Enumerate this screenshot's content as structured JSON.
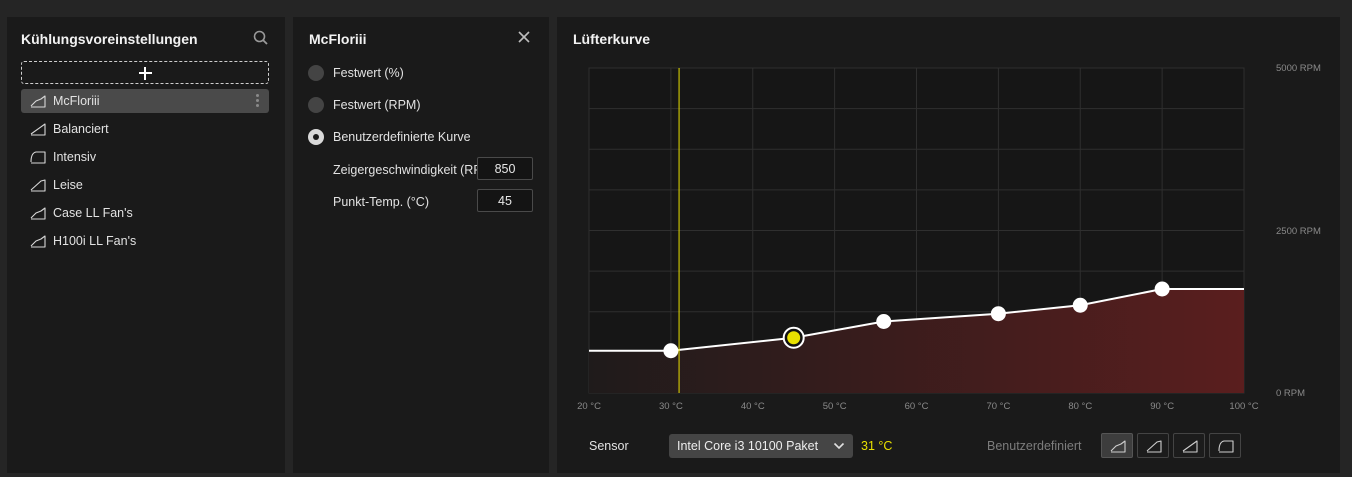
{
  "presets_panel": {
    "title": "Kühlungsvoreinstellungen",
    "items": [
      {
        "label": "McFloriii",
        "icon": "curve-custom-icon",
        "selected": true
      },
      {
        "label": "Balanciert",
        "icon": "curve-balanced-icon"
      },
      {
        "label": "Intensiv",
        "icon": "curve-intensive-icon"
      },
      {
        "label": "Leise",
        "icon": "curve-quiet-icon"
      },
      {
        "label": "Case LL Fan's",
        "icon": "curve-custom-icon"
      },
      {
        "label": "H100i LL Fan's",
        "icon": "curve-custom-icon"
      }
    ]
  },
  "settings_panel": {
    "title": "McFloriii",
    "options": [
      {
        "label": "Festwert (%)",
        "checked": false
      },
      {
        "label": "Festwert (RPM)",
        "checked": false
      },
      {
        "label": "Benutzerdefinierte Kurve",
        "checked": true
      }
    ],
    "pointer_speed_label": "Zeigergeschwindigkeit (RPM)",
    "pointer_speed_value": "850",
    "point_temp_label": "Punkt-Temp. (°C)",
    "point_temp_value": "45"
  },
  "curve_panel": {
    "title": "Lüfterkurve",
    "sensor_label": "Sensor",
    "sensor_value": "Intel Core i3 10100 Paket",
    "sensor_temp": "31 °C",
    "mode_label": "Benutzerdefiniert",
    "modes": [
      "curve-custom-icon",
      "curve-quiet-icon",
      "curve-balanced-icon",
      "curve-intensive-icon"
    ],
    "active_mode": 0
  },
  "chart_data": {
    "type": "line",
    "xlabel": "",
    "ylabel": "",
    "xlim": [
      20,
      100
    ],
    "ylim": [
      0,
      5000
    ],
    "x_ticks": [
      "20 °C",
      "30 °C",
      "40 °C",
      "50 °C",
      "60 °C",
      "70 °C",
      "80 °C",
      "90 °C",
      "100 °C"
    ],
    "y_ticks": [
      "5000 RPM",
      "2500 RPM",
      "0 RPM"
    ],
    "grid": true,
    "points": [
      {
        "x": 30,
        "y": 650
      },
      {
        "x": 45,
        "y": 850,
        "selected": true
      },
      {
        "x": 56,
        "y": 1100
      },
      {
        "x": 70,
        "y": 1220
      },
      {
        "x": 80,
        "y": 1350
      },
      {
        "x": 90,
        "y": 1600
      }
    ],
    "left_flat_from": 20,
    "right_flat_to": 100,
    "current_temp": 31,
    "colors": {
      "line": "#ffffff",
      "fill": "#5a1e1e",
      "selected_point": "#e8e000",
      "current_temp_line": "#e8e000"
    }
  }
}
